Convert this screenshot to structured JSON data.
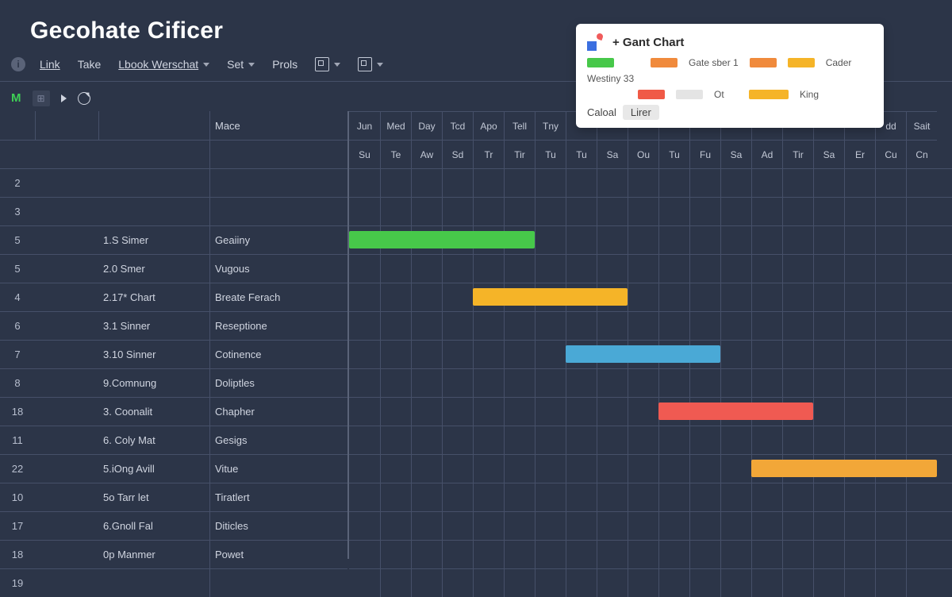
{
  "title": "Gecohate Cificer",
  "toolbar": {
    "link": "Link",
    "take": "Take",
    "lbook": "Lbook Werschat",
    "set": "Set",
    "prols": "Prols"
  },
  "tabbar": {
    "m": "M"
  },
  "row_numbers": [
    "2",
    "3",
    "5",
    "5",
    "4",
    "6",
    "7",
    "8",
    "18",
    "11",
    "22",
    "10",
    "17",
    "18",
    "19"
  ],
  "task_header_c3": "Mace",
  "tasks": [
    {
      "id": "1.S Simer",
      "name": "Geaiiny"
    },
    {
      "id": "2.0 Smer",
      "name": "Vugous"
    },
    {
      "id": "2.17* Chart",
      "name": "Breate Ferach"
    },
    {
      "id": "3.1 Sinner",
      "name": "Reseptione"
    },
    {
      "id": "3.10 Sinner",
      "name": "Cotinence"
    },
    {
      "id": "9.Comnung",
      "name": "Doliptles"
    },
    {
      "id": "3. Coonalit",
      "name": "Chapher"
    },
    {
      "id": "6. Coly Mat",
      "name": "Gesigs"
    },
    {
      "id": "5.iOng Avill",
      "name": "Vitue"
    },
    {
      "id": "5o Tarr let",
      "name": "Tiratlert"
    },
    {
      "id": "6.Gnoll Fal",
      "name": "Diticles"
    },
    {
      "id": "0p Manmer",
      "name": "Powet"
    }
  ],
  "gantt_header1": [
    "Jun",
    "Med",
    "Day",
    "Tcd",
    "Apo",
    "Tell",
    "Tny",
    "",
    "",
    "",
    "",
    "",
    "",
    "",
    "",
    "",
    "",
    "dd",
    "Sait"
  ],
  "gantt_header2": [
    "Su",
    "Te",
    "Aw",
    "Sd",
    "Tr",
    "Tir",
    "Tu",
    "Tu",
    "Sa",
    "Ou",
    "Tu",
    "Fu",
    "Sa",
    "Ad",
    "Tir",
    "Sa",
    "Er",
    "Cu",
    "Cn"
  ],
  "legend": {
    "title": "+ Gant Chart",
    "items": [
      {
        "color": "#47c84a",
        "label": ""
      },
      {
        "color": "#f08a3c",
        "label": "Gate sber 1"
      },
      {
        "color": "#f5b428",
        "label": "Cader"
      },
      {
        "label_only": "Westiny 33"
      },
      {
        "color": "#f05a46",
        "label": ""
      },
      {
        "label_only": "Ot"
      },
      {
        "color": "#f5b428",
        "label": ""
      },
      {
        "label_only": "King"
      }
    ],
    "footer_text": "Caloal",
    "footer_btn": "Lirer"
  },
  "chart_data": {
    "type": "gantt",
    "columns": 19,
    "column_labels_top": [
      "Jun",
      "Med",
      "Day",
      "Tcd",
      "Apo",
      "Tell",
      "Tny",
      "",
      "",
      "",
      "",
      "",
      "",
      "",
      "",
      "",
      "",
      "dd",
      "Sait"
    ],
    "column_labels_bottom": [
      "Su",
      "Te",
      "Aw",
      "Sd",
      "Tr",
      "Tir",
      "Tu",
      "Tu",
      "Sa",
      "Ou",
      "Tu",
      "Fu",
      "Sa",
      "Ad",
      "Tir",
      "Sa",
      "Er",
      "Cu",
      "Cn"
    ],
    "rows": [
      {
        "task": "Geaiiny",
        "start": 0,
        "end": 6,
        "color": "#47c84a"
      },
      {
        "task": "Vugous"
      },
      {
        "task": "Breate Ferach",
        "start": 4,
        "end": 9,
        "color": "#f5b428"
      },
      {
        "task": "Reseptione"
      },
      {
        "task": "Cotinence",
        "start": 7,
        "end": 12,
        "color": "#4aa9d6"
      },
      {
        "task": "Doliptles"
      },
      {
        "task": "Chapher",
        "start": 10,
        "end": 15,
        "color": "#f05a52"
      },
      {
        "task": "Gesigs"
      },
      {
        "task": "Vitue",
        "start": 13,
        "end": 19,
        "color": "#f2a738"
      },
      {
        "task": "Tiratlert"
      },
      {
        "task": "Diticles"
      },
      {
        "task": "Powet"
      }
    ]
  }
}
